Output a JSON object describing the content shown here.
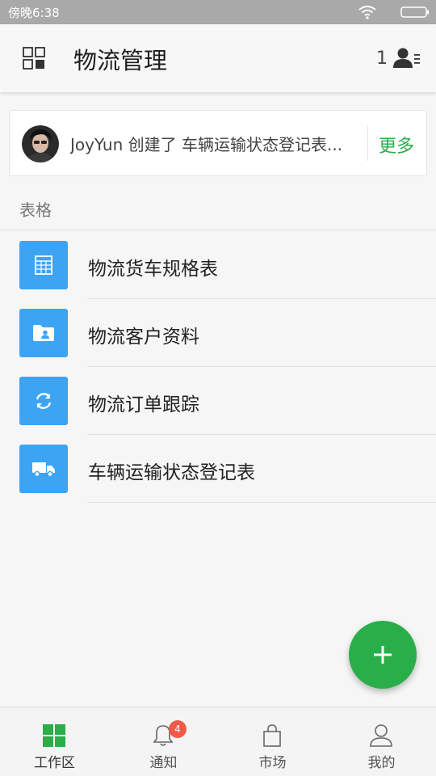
{
  "status_bar": {
    "time": "傍晚6:38"
  },
  "app_bar": {
    "title": "物流管理",
    "member_count": "1"
  },
  "activity": {
    "text": "JoyYun 创建了 车辆运输状态登记表...",
    "more_label": "更多"
  },
  "section": {
    "label": "表格"
  },
  "list": {
    "items": [
      {
        "label": "物流货车规格表",
        "icon": "table-icon"
      },
      {
        "label": "物流客户资料",
        "icon": "contact-folder-icon"
      },
      {
        "label": "物流订单跟踪",
        "icon": "sync-icon"
      },
      {
        "label": "车辆运输状态登记表",
        "icon": "truck-icon"
      }
    ]
  },
  "bottom_nav": {
    "items": [
      {
        "label": "工作区",
        "icon": "grid-icon",
        "active": true
      },
      {
        "label": "通知",
        "icon": "bell-icon",
        "badge": "4"
      },
      {
        "label": "市场",
        "icon": "shopping-bag-icon"
      },
      {
        "label": "我的",
        "icon": "person-icon"
      }
    ]
  },
  "colors": {
    "accent": "#2aae4a",
    "list_icon_bg": "#3da4f4",
    "badge": "#f05a4a",
    "status_bar": "#a9a9a9"
  }
}
